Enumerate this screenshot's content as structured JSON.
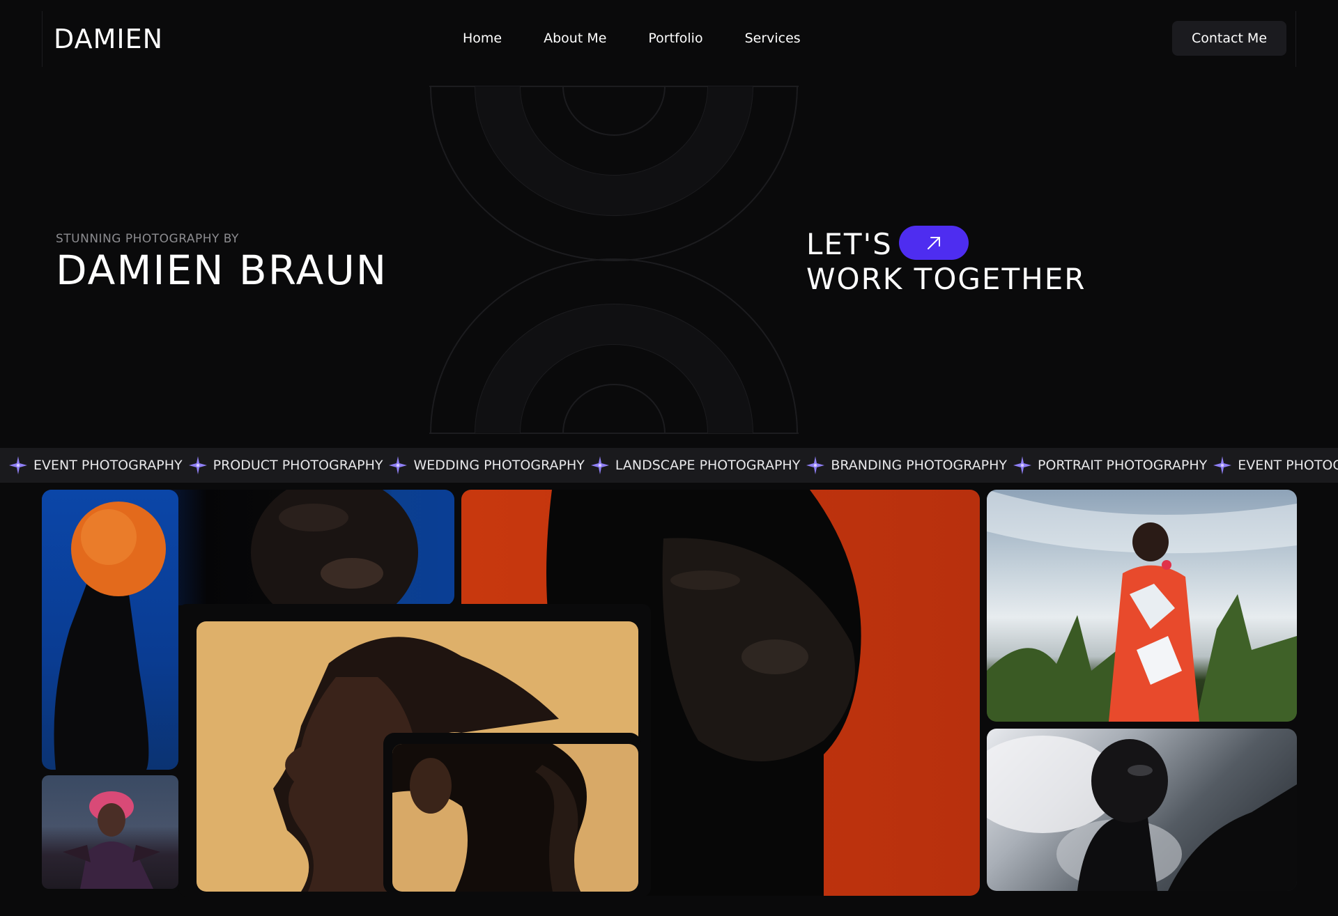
{
  "brand": {
    "logo": "DAMIEN"
  },
  "nav": {
    "items": [
      {
        "label": "Home"
      },
      {
        "label": "About Me"
      },
      {
        "label": "Portfolio"
      },
      {
        "label": "Services"
      }
    ],
    "contact_label": "Contact Me"
  },
  "hero": {
    "subtitle": "STUNNING PHOTOGRAPHY BY",
    "title": "DAMIEN BRAUN",
    "cta_line1": "LET'S",
    "cta_line2": "WORK TOGETHER",
    "cta_icon": "arrow-up-right-icon"
  },
  "ticker": {
    "items": [
      "EVENT PHOTOGRAPHY",
      "PRODUCT PHOTOGRAPHY",
      "WEDDING PHOTOGRAPHY",
      "LANDSCAPE PHOTOGRAPHY",
      "BRANDING PHOTOGRAPHY",
      "PORTRAIT PHOTOGRAPHY",
      "EVENT PHOTOGRAPHY"
    ],
    "separator_icon": "sparkle-icon"
  },
  "colors": {
    "background": "#0a0a0b",
    "accent": "#4e2df0",
    "ticker_bg": "#1a1a1d",
    "sparkle": "#8f7ff5"
  }
}
